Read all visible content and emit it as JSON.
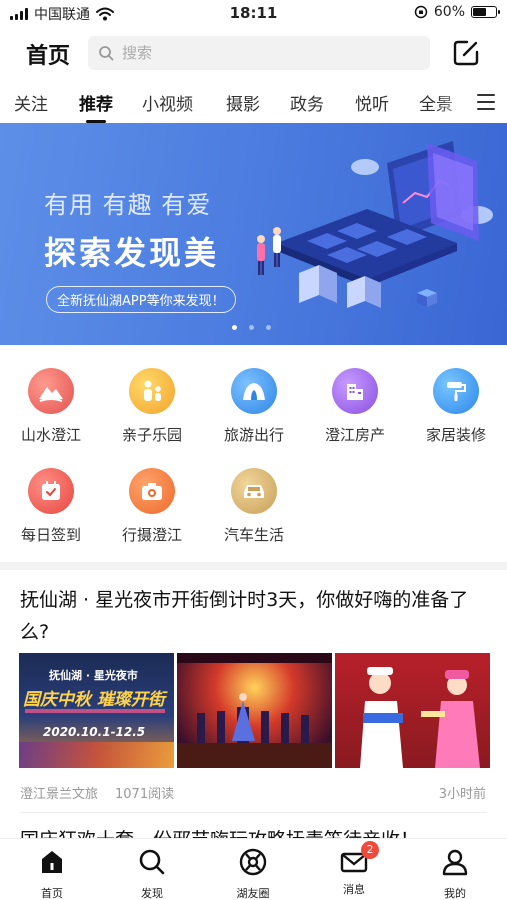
{
  "status_bar": {
    "carrier": "中国联通",
    "time": "18:11",
    "battery": "60%",
    "battery_level": 0.6
  },
  "header": {
    "title": "首页",
    "search_placeholder": "搜索"
  },
  "tabs": [
    {
      "label": "关注",
      "active": false
    },
    {
      "label": "推荐",
      "active": true
    },
    {
      "label": "小视频",
      "active": false
    },
    {
      "label": "摄影",
      "active": false
    },
    {
      "label": "政务",
      "active": false
    },
    {
      "label": "悦听",
      "active": false
    },
    {
      "label": "全景",
      "active": false
    }
  ],
  "banner": {
    "line1": "有用 有趣 有爱",
    "line2": "探索发现美",
    "line3": "全新抚仙湖APP等你来发现！",
    "slide_count": 3,
    "active_slide": 1
  },
  "grid": [
    {
      "label": "山水澄江",
      "icon": "landscape-icon",
      "color": "#ee6b6b"
    },
    {
      "label": "亲子乐园",
      "icon": "family-icon",
      "color": "#f6b73c"
    },
    {
      "label": "旅游出行",
      "icon": "tent-icon",
      "color": "#4c9bea"
    },
    {
      "label": "澄江房产",
      "icon": "building-icon",
      "color": "#a36bdf"
    },
    {
      "label": "家居装修",
      "icon": "paint-roller-icon",
      "color": "#3f9ff0"
    },
    {
      "label": "每日签到",
      "icon": "calendar-check-icon",
      "color": "#ee6060"
    },
    {
      "label": "行摄澄江",
      "icon": "camera-icon",
      "color": "#f07a3e"
    },
    {
      "label": "汽车生活",
      "icon": "car-icon",
      "color": "#d8b06a"
    }
  ],
  "article": {
    "title": "抚仙湖 · 星光夜市开街倒计时3天，你做好嗨的准备了么?",
    "thumb1_caption": "抚仙湖 · 星光夜市",
    "thumb1_banner": "国庆中秋 璀璨开街",
    "thumb1_date": "2020.10.1-12.5",
    "source": "澄江景兰文旅",
    "reads": "1071阅读",
    "time": "3小时前"
  },
  "next_article": {
    "title": "国庆狂欢十套，份邪节嗨玩攻略抚毒笛待亲收！"
  },
  "bottom_nav": [
    {
      "label": "首页",
      "icon": "home-icon",
      "active": true
    },
    {
      "label": "发现",
      "icon": "discover-search-icon",
      "active": false
    },
    {
      "label": "湖友圈",
      "icon": "circle-community-icon",
      "active": false
    },
    {
      "label": "消息",
      "icon": "message-mail-icon",
      "active": false,
      "badge": "2"
    },
    {
      "label": "我的",
      "icon": "profile-icon",
      "active": false
    }
  ],
  "colors": {
    "banner_start": "#5d8fe8",
    "banner_end": "#3a66d4",
    "badge": "#f04a3c"
  }
}
